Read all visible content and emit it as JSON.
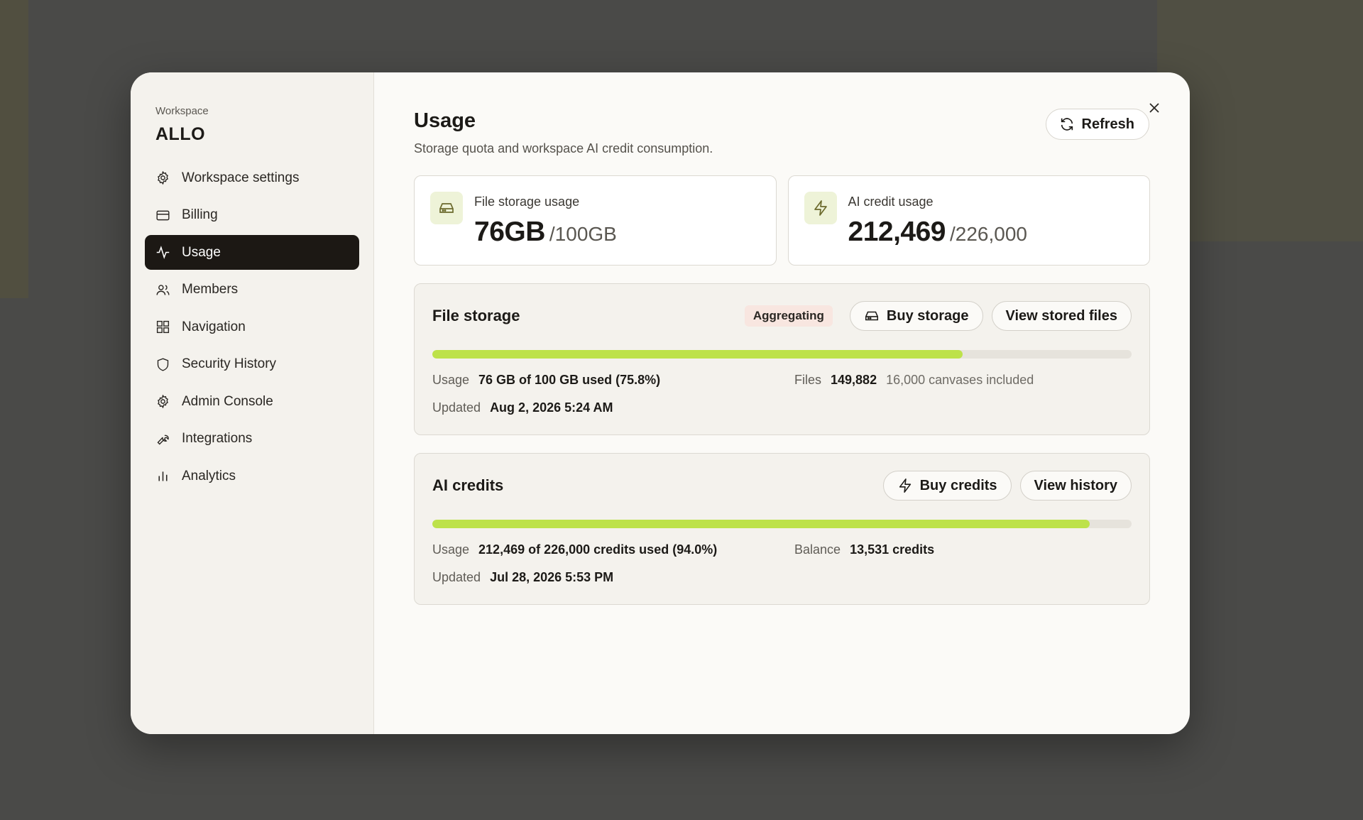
{
  "sidebar": {
    "caption": "Workspace",
    "workspace_name": "ALLO",
    "items": [
      {
        "label": "Workspace settings",
        "icon": "gear-icon"
      },
      {
        "label": "Billing",
        "icon": "card-icon"
      },
      {
        "label": "Usage",
        "icon": "activity-icon",
        "active": true
      },
      {
        "label": "Members",
        "icon": "users-icon"
      },
      {
        "label": "Navigation",
        "icon": "grid-icon"
      },
      {
        "label": "Security History",
        "icon": "shield-icon"
      },
      {
        "label": "Admin Console",
        "icon": "gear-icon"
      },
      {
        "label": "Integrations",
        "icon": "wrench-icon"
      },
      {
        "label": "Analytics",
        "icon": "bar-chart-icon"
      }
    ]
  },
  "header": {
    "title": "Usage",
    "subtitle": "Storage quota and workspace AI credit consumption.",
    "refresh_label": "Refresh"
  },
  "stats": {
    "storage": {
      "label": "File storage usage",
      "value": "76GB",
      "limit": "/100GB"
    },
    "credits": {
      "label": "AI credit usage",
      "value": "212,469",
      "limit": "/226,000"
    }
  },
  "file_storage": {
    "title": "File storage",
    "badge": "Aggregating",
    "buy_label": "Buy storage",
    "view_label": "View stored files",
    "progress": 0.758,
    "usage_label": "Usage",
    "usage_value": "76 GB of 100 GB used (75.8%)",
    "files_label": "Files",
    "files_value": "149,882",
    "files_extra": "16,000 canvases included",
    "updated_label": "Updated",
    "updated_value": "Aug 2, 2026 5:24 AM"
  },
  "ai_credits": {
    "title": "AI credits",
    "buy_label": "Buy credits",
    "view_label": "View history",
    "progress": 0.94,
    "usage_label": "Usage",
    "usage_value": "212,469 of 226,000 credits used (94.0%)",
    "balance_label": "Balance",
    "balance_value": "13,531 credits",
    "updated_label": "Updated",
    "updated_value": "Jul 28, 2026 5:53 PM"
  },
  "colors": {
    "accent": "#bde24a",
    "active_nav": "#1c1814",
    "badge_bg": "#f8e6e0"
  }
}
